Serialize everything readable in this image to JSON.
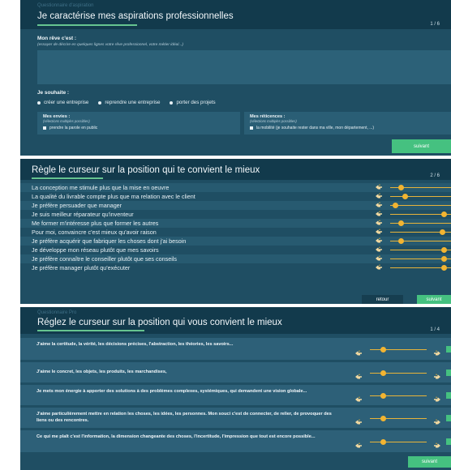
{
  "panel1": {
    "top_small": "Questionnaire d'aspiration",
    "title": "Je caractérise mes aspirations professionnelles",
    "step": "1 / 6",
    "dream_label": "Mon rêve c'est :",
    "dream_hint": "(essayer de décrire en quelques lignes votre rêve professionnel, votre métier idéal...)",
    "dream_value": "",
    "wish_label": "Je souhaite :",
    "wish_options": [
      "créer une entreprise",
      "reprendre une entreprise",
      "porter des projets"
    ],
    "envies": {
      "title": "Mes envies :",
      "hint": "(sélections multiples possibles)",
      "option": "prendre la parole en public"
    },
    "reticences": {
      "title": "Mes réticences :",
      "hint": "(sélections multiples possibles)",
      "option": "la mobilité (je souhaite rester dans ma ville, mon département, ...)"
    },
    "next": "suivant"
  },
  "panel2": {
    "title": "Règle le curseur sur la position qui te convient le mieux",
    "step": "2 / 6",
    "statements": [
      {
        "text": "La conception me stimule plus que la mise en oeuvre",
        "value": 0.15
      },
      {
        "text": "La qualité du livrable compte plus que ma relation avec le client",
        "value": 0.22
      },
      {
        "text": "Je préfère persuader que manager",
        "value": 0.05
      },
      {
        "text": "Je suis meilleur réparateur qu'inventeur",
        "value": 0.92
      },
      {
        "text": "Me former m'intéresse plus que former les autres",
        "value": 0.15
      },
      {
        "text": "Pour moi, convaincre c'est mieux qu'avoir raison",
        "value": 0.9
      },
      {
        "text": "Je préfère acquérir que fabriquer les choses dont j'ai besoin",
        "value": 0.15
      },
      {
        "text": "Je développe mon réseau plutôt que mes savoirs",
        "value": 0.92
      },
      {
        "text": "Je préfère connaître le conseiller plutôt que ses conseils",
        "value": 0.92
      },
      {
        "text": "Je préfère manager plutôt qu'exécuter",
        "value": 0.92
      }
    ],
    "back": "retour",
    "next": "suivant"
  },
  "panel3": {
    "top_small": "Questionnaire Pro",
    "title": "Réglez le curseur sur la position qui vous convient le mieux",
    "step": "1 / 4",
    "questions": [
      {
        "text": "J'aime la certitude, la vérité, les décisions précises, l'abstraction, les théories, les savoirs...",
        "value": 0.2
      },
      {
        "text": "J'aime le concret, les objets, les produits, les marchandises,",
        "value": 0.2
      },
      {
        "text": "Je mets mon énergie à apporter des solutions à des problèmes complexes, systémiques, qui demandent une vision globale...",
        "value": 0.2
      },
      {
        "text": "J'aime particulièrement mettre en relation les choses, les idées, les personnes. Mon souci c'est de connecter, de relier, de provoquer des liens ou des rencontres.",
        "value": 0.2
      },
      {
        "text": "Ce qui me plaît c'est l'information, la dimension changeante des choses, l'incertitude, l'impression que tout est encore possible...",
        "value": 0.2
      }
    ],
    "next": "suivant"
  },
  "colors": {
    "panel": "#1f4e63",
    "header": "#123a4c",
    "accent_green": "#45c180",
    "knob": "#f2b431"
  },
  "icons": {
    "slider_left": "pointing-hand-left-icon",
    "slider_right": "pointing-hand-right-icon"
  }
}
